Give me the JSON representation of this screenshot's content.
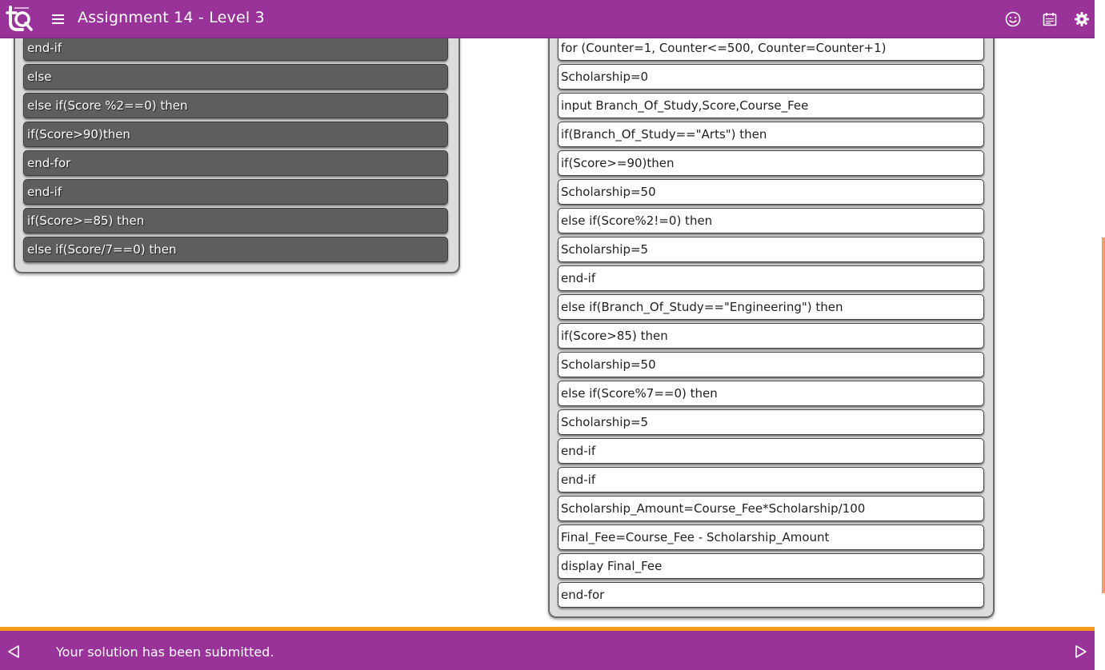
{
  "header": {
    "title": "Assignment 14 - Level 3"
  },
  "colors": {
    "brand": "#993399",
    "accent": "#f59a1a",
    "scroll": "#ef9a7a"
  },
  "icons": {
    "logo": "letsq-logo",
    "menu": "hamburger-menu-icon",
    "smiley": "smiley-icon",
    "calendar": "calendar-icon",
    "settings": "gear-icon",
    "prev": "triangle-left-icon",
    "next": "triangle-right-icon"
  },
  "source_blocks": [
    "end-if",
    "else",
    "else if(Score %2==0) then",
    "if(Score>90)then",
    "end-for",
    "end-if",
    "if(Score>=85) then",
    "else if(Score/7==0) then"
  ],
  "solution_blocks": [
    "for (Counter=1, Counter<=500, Counter=Counter+1)",
    "Scholarship=0",
    "input Branch_Of_Study,Score,Course_Fee",
    "if(Branch_Of_Study==\"Arts\") then",
    "if(Score>=90)then",
    "Scholarship=50",
    "else if(Score%2!=0) then",
    "Scholarship=5",
    "end-if",
    "else if(Branch_Of_Study==\"Engineering\") then",
    "if(Score>85) then",
    "Scholarship=50",
    "else if(Score%7==0) then",
    "Scholarship=5",
    "end-if",
    "end-if",
    "Scholarship_Amount=Course_Fee*Scholarship/100",
    "Final_Fee=Course_Fee - Scholarship_Amount",
    "display Final_Fee",
    "end-for"
  ],
  "footer": {
    "status": "Your solution has been submitted."
  }
}
